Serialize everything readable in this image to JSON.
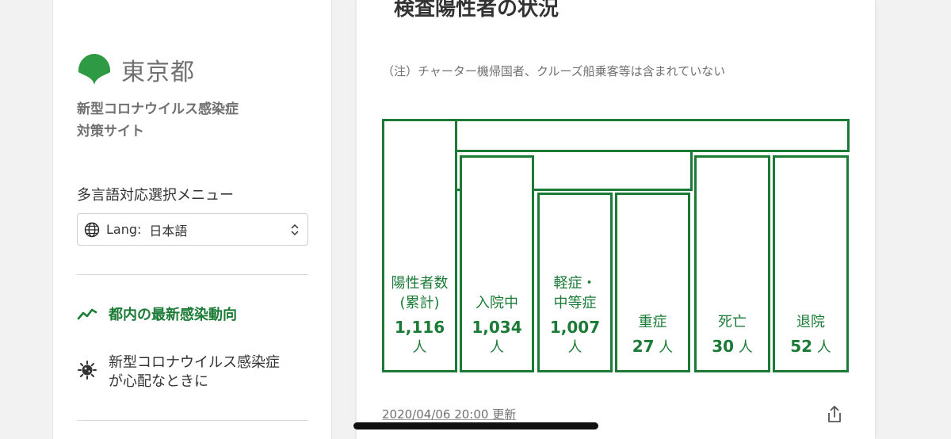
{
  "sidebar": {
    "logo_text": "東京都",
    "site_title_line1": "新型コロナウイルス感染症",
    "site_title_line2": "対策サイト",
    "lang_menu_label": "多言語対応選択メニュー",
    "lang_prefix": "Lang:",
    "lang_selected": "日本語",
    "nav": [
      {
        "label": "都内の最新感染動向",
        "icon": "trend-chart-icon",
        "active": true
      },
      {
        "label_line1": "新型コロナウイルス感染症",
        "label_line2": "が心配なときに",
        "icon": "virus-icon",
        "active": false
      }
    ]
  },
  "card": {
    "title": "検査陽性者の状況",
    "note": "（注）チャーター機帰国者、クルーズ船乗客等は含まれていない",
    "boxes": {
      "positive": {
        "label1": "陽性者数",
        "label2": "(累計)",
        "value": "1,116",
        "unit": "人"
      },
      "hospitalized": {
        "label1": "入院中",
        "value": "1,034",
        "unit": "人"
      },
      "mild": {
        "label1": "軽症・",
        "label2": "中等症",
        "value": "1,007",
        "unit": "人"
      },
      "severe": {
        "label1": "重症",
        "value": "27",
        "unit": "人"
      },
      "deceased": {
        "label1": "死亡",
        "value": "30",
        "unit": "人"
      },
      "discharged": {
        "label1": "退院",
        "value": "52",
        "unit": "人"
      }
    },
    "updated": "2020/04/06 20:00 更新"
  },
  "colors": {
    "accent": "#1b7b36",
    "muted": "#707070"
  }
}
